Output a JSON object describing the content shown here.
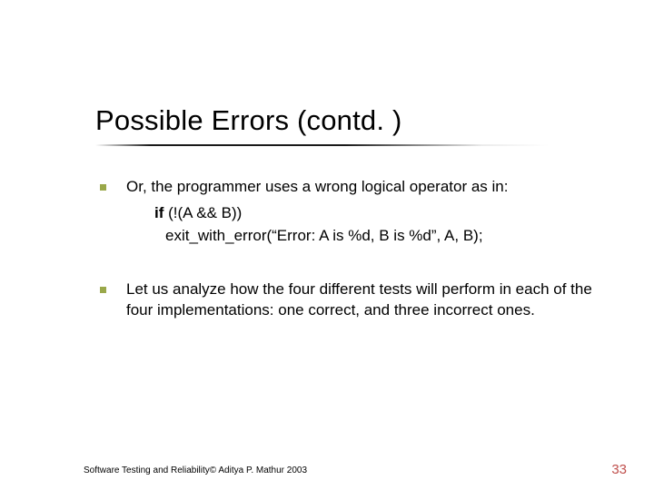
{
  "title": "Possible Errors (contd. )",
  "bullets": [
    {
      "text": "Or, the programmer uses a wrong logical operator as in:",
      "code_if": "if",
      "code_cond": " (!(A && B))",
      "code_call": "exit_with_error(“Error: A is %d, B is %d”, A, B);"
    },
    {
      "text": "Let us analyze how the four different tests will perform in each of the four implementations: one correct, and three incorrect ones."
    }
  ],
  "footer": "Software Testing and Reliability© Aditya P. Mathur 2003",
  "page_number": "33"
}
